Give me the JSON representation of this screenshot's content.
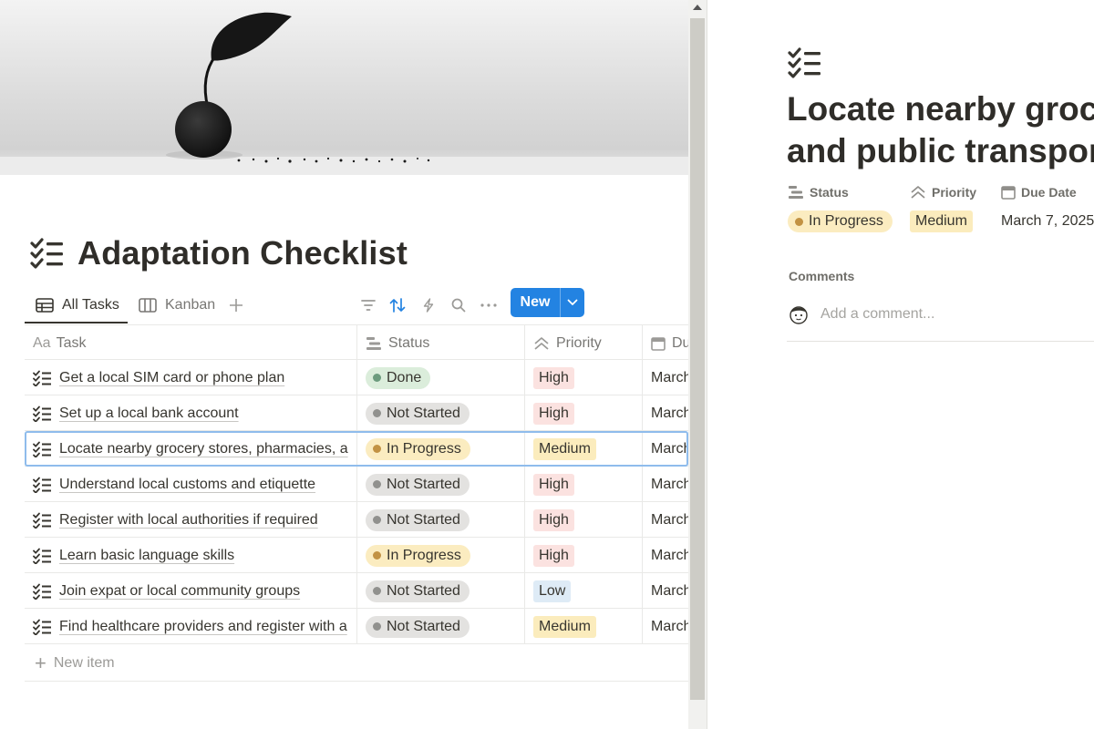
{
  "database": {
    "title": "Adaptation Checklist",
    "icon": "checklist-icon",
    "tabs": [
      {
        "label": "All Tasks",
        "icon": "table-icon",
        "active": true
      },
      {
        "label": "Kanban",
        "icon": "board-icon",
        "active": false
      }
    ],
    "toolbar": {
      "new_label": "New",
      "icons": [
        "add-view-icon",
        "filter-icon",
        "sort-icon",
        "automation-icon",
        "search-icon",
        "more-icon",
        "chevron-down-icon"
      ]
    },
    "columns": {
      "task": "Task",
      "status": "Status",
      "priority": "Priority",
      "due": "Du"
    },
    "rows": [
      {
        "task": "Get a local SIM card or phone plan",
        "status": "Done",
        "priority": "High",
        "due": "March"
      },
      {
        "task": "Set up a local bank account",
        "status": "Not Started",
        "priority": "High",
        "due": "March"
      },
      {
        "task": "Locate nearby grocery stores, pharmacies, a",
        "status": "In Progress",
        "priority": "Medium",
        "due": "March"
      },
      {
        "task": "Understand local customs and etiquette",
        "status": "Not Started",
        "priority": "High",
        "due": "March"
      },
      {
        "task": "Register with local authorities if required",
        "status": "Not Started",
        "priority": "High",
        "due": "March"
      },
      {
        "task": "Learn basic language skills",
        "status": "In Progress",
        "priority": "High",
        "due": "March"
      },
      {
        "task": "Join expat or local community groups",
        "status": "Not Started",
        "priority": "Low",
        "due": "March"
      },
      {
        "task": "Find healthcare providers and register with a",
        "status": "Not Started",
        "priority": "Medium",
        "due": "March"
      }
    ],
    "selected_row": 2,
    "new_item_label": "New item"
  },
  "status_styles": {
    "Done": {
      "bg": "#dbeddb",
      "dot": "#6c9b7d"
    },
    "Not Started": {
      "bg": "#e3e2e0",
      "dot": "#91918e"
    },
    "In Progress": {
      "bg": "#fbecc0",
      "dot": "#c29243"
    }
  },
  "priority_styles": {
    "High": {
      "bg": "#fbe2e0"
    },
    "Medium": {
      "bg": "#fbecbd"
    },
    "Low": {
      "bg": "#deebf6"
    }
  },
  "detail": {
    "title_lines": [
      "Locate nearby groc",
      "and public transpor"
    ],
    "icon": "checklist-icon",
    "properties": {
      "status_label": "Status",
      "priority_label": "Priority",
      "due_label": "Due Date",
      "status_value": "In Progress",
      "priority_value": "Medium",
      "due_value": "March 7, 2025"
    },
    "comments_label": "Comments",
    "comment_placeholder": "Add a comment..."
  }
}
